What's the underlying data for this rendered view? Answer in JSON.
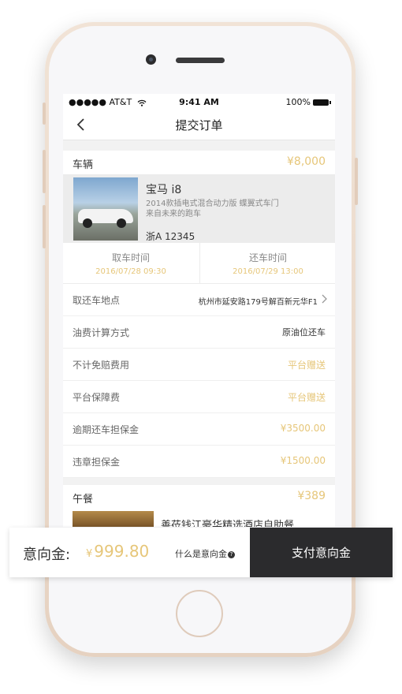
{
  "status_bar": {
    "carrier": "●●●●● AT&T",
    "time": "9:41 AM",
    "battery": "100%"
  },
  "nav": {
    "title": "提交订单"
  },
  "vehicle_section": {
    "label": "车辆",
    "price": "¥8,000"
  },
  "car": {
    "name": "宝马 i8",
    "description": "2014款插电式混合动力版 蝶翼式车门 来自未来的跑车",
    "plate": "浙A 12345"
  },
  "times": {
    "pickup_label": "取车时间",
    "pickup_value": "2016/07/28 09:30",
    "return_label": "还车时间",
    "return_value": "2016/07/29 13:00"
  },
  "rows": [
    {
      "key": "取还车地点",
      "value": "杭州市延安路179号解百新元华F1"
    },
    {
      "key": "油费计算方式",
      "value": "原油位还车"
    },
    {
      "key": "不计免赔费用",
      "value": "平台赠送"
    },
    {
      "key": "平台保障费",
      "value": "平台赠送"
    },
    {
      "key": "逾期还车担保金",
      "value": "¥3500.00"
    },
    {
      "key": "违章担保金",
      "value": "¥1500.00"
    }
  ],
  "lunch_section": {
    "label": "午餐",
    "price": "¥389"
  },
  "hotel": {
    "name": "善莅钱江豪华精选酒店自助餐"
  },
  "bottom_bar": {
    "label": "意向金:",
    "yen": "¥",
    "amount": "999.80",
    "help": "什么是意向金",
    "help_icon": "?",
    "pay_button": "支付意向金"
  },
  "colors": {
    "accent": "#e6c679",
    "pay_button": "#2b2b2d"
  }
}
